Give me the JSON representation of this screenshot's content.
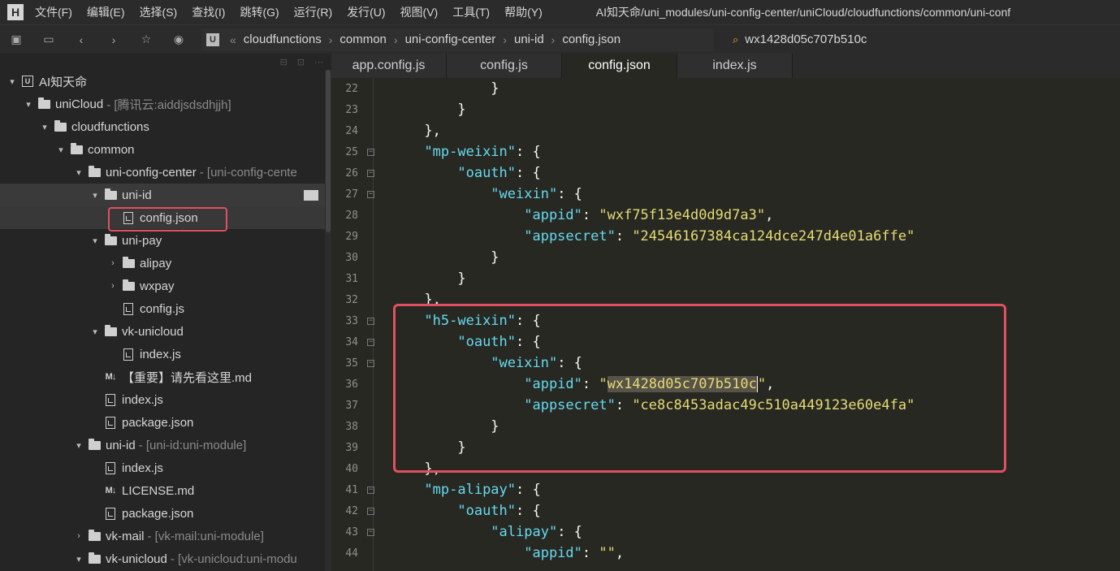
{
  "menubar": {
    "logo": "H",
    "items": [
      "文件(F)",
      "编辑(E)",
      "选择(S)",
      "查找(I)",
      "跳转(G)",
      "运行(R)",
      "发行(U)",
      "视图(V)",
      "工具(T)",
      "帮助(Y)"
    ],
    "title": "AI知天命/uni_modules/uni-config-center/uniCloud/cloudfunctions/common/uni-conf"
  },
  "toolbar": {
    "breadcrumb": [
      "cloudfunctions",
      "common",
      "uni-config-center",
      "uni-id",
      "config.json"
    ],
    "search_value": "wx1428d05c707b510c"
  },
  "sidebar": {
    "tree": [
      {
        "label": "AI知天命",
        "muted": "",
        "arrow": "▾",
        "icon": "project"
      },
      {
        "label": "uniCloud",
        "muted": "- [腾讯云:aiddjsdsdhjjh]",
        "arrow": "▾",
        "icon": "folder"
      },
      {
        "label": "cloudfunctions",
        "muted": "",
        "arrow": "▾",
        "icon": "folder"
      },
      {
        "label": "common",
        "muted": "",
        "arrow": "▾",
        "icon": "folder"
      },
      {
        "label": "uni-config-center",
        "muted": "- [uni-config-cente",
        "arrow": "▾",
        "icon": "folder"
      },
      {
        "label": "uni-id",
        "muted": "",
        "arrow": "▾",
        "icon": "folder"
      },
      {
        "label": "config.json",
        "muted": "",
        "arrow": "",
        "icon": "file"
      },
      {
        "label": "uni-pay",
        "muted": "",
        "arrow": "▾",
        "icon": "folder"
      },
      {
        "label": "alipay",
        "muted": "",
        "arrow": "›",
        "icon": "folder"
      },
      {
        "label": "wxpay",
        "muted": "",
        "arrow": "›",
        "icon": "folder"
      },
      {
        "label": "config.js",
        "muted": "",
        "arrow": "",
        "icon": "file"
      },
      {
        "label": "vk-unicloud",
        "muted": "",
        "arrow": "▾",
        "icon": "folder"
      },
      {
        "label": "index.js",
        "muted": "",
        "arrow": "",
        "icon": "file"
      },
      {
        "label": "【重要】请先看这里.md",
        "muted": "",
        "arrow": "",
        "icon": "md"
      },
      {
        "label": "index.js",
        "muted": "",
        "arrow": "",
        "icon": "file"
      },
      {
        "label": "package.json",
        "muted": "",
        "arrow": "",
        "icon": "file"
      },
      {
        "label": "uni-id",
        "muted": "- [uni-id:uni-module]",
        "arrow": "▾",
        "icon": "folder"
      },
      {
        "label": "index.js",
        "muted": "",
        "arrow": "",
        "icon": "file"
      },
      {
        "label": "LICENSE.md",
        "muted": "",
        "arrow": "",
        "icon": "md"
      },
      {
        "label": "package.json",
        "muted": "",
        "arrow": "",
        "icon": "file"
      },
      {
        "label": "vk-mail",
        "muted": "- [vk-mail:uni-module]",
        "arrow": "›",
        "icon": "folder"
      },
      {
        "label": "vk-unicloud",
        "muted": "- [vk-unicloud:uni-modu",
        "arrow": "▾",
        "icon": "folder"
      }
    ]
  },
  "editor": {
    "tabs": [
      "app.config.js",
      "config.js",
      "config.json",
      "index.js"
    ],
    "active_tab": 2,
    "lines": [
      {
        "n": "22",
        "fold": false,
        "indent": 12,
        "parts": [
          [
            "p",
            "}"
          ]
        ]
      },
      {
        "n": "23",
        "fold": false,
        "indent": 8,
        "parts": [
          [
            "p",
            "}"
          ]
        ]
      },
      {
        "n": "24",
        "fold": false,
        "indent": 4,
        "parts": [
          [
            "p",
            "},"
          ]
        ]
      },
      {
        "n": "25",
        "fold": true,
        "indent": 4,
        "parts": [
          [
            "k",
            "\"mp-weixin\""
          ],
          [
            "p",
            ": {"
          ]
        ]
      },
      {
        "n": "26",
        "fold": true,
        "indent": 8,
        "parts": [
          [
            "k",
            "\"oauth\""
          ],
          [
            "p",
            ": {"
          ]
        ]
      },
      {
        "n": "27",
        "fold": true,
        "indent": 12,
        "parts": [
          [
            "k",
            "\"weixin\""
          ],
          [
            "p",
            ": {"
          ]
        ]
      },
      {
        "n": "28",
        "fold": false,
        "indent": 16,
        "parts": [
          [
            "k",
            "\"appid\""
          ],
          [
            "p",
            ": "
          ],
          [
            "s",
            "\"wxf75f13e4d0d9d7a3\""
          ],
          [
            "p",
            ","
          ]
        ]
      },
      {
        "n": "29",
        "fold": false,
        "indent": 16,
        "parts": [
          [
            "k",
            "\"appsecret\""
          ],
          [
            "p",
            ": "
          ],
          [
            "s",
            "\"24546167384ca124dce247d4e01a6ffe\""
          ]
        ]
      },
      {
        "n": "30",
        "fold": false,
        "indent": 12,
        "parts": [
          [
            "p",
            "}"
          ]
        ]
      },
      {
        "n": "31",
        "fold": false,
        "indent": 8,
        "parts": [
          [
            "p",
            "}"
          ]
        ]
      },
      {
        "n": "32",
        "fold": false,
        "indent": 4,
        "parts": [
          [
            "p",
            "},"
          ]
        ]
      },
      {
        "n": "33",
        "fold": true,
        "indent": 4,
        "parts": [
          [
            "k",
            "\"h5-weixin\""
          ],
          [
            "p",
            ": {"
          ]
        ]
      },
      {
        "n": "34",
        "fold": true,
        "indent": 8,
        "parts": [
          [
            "k",
            "\"oauth\""
          ],
          [
            "p",
            ": {"
          ]
        ]
      },
      {
        "n": "35",
        "fold": true,
        "indent": 12,
        "parts": [
          [
            "k",
            "\"weixin\""
          ],
          [
            "p",
            ": {"
          ]
        ]
      },
      {
        "n": "36",
        "fold": false,
        "indent": 16,
        "parts": [
          [
            "k",
            "\"appid\""
          ],
          [
            "p",
            ": "
          ],
          [
            "s",
            "\""
          ],
          [
            "sel",
            "wx1428d05c707b510c"
          ],
          [
            "cursor",
            ""
          ],
          [
            "s",
            "\""
          ],
          [
            "p",
            ","
          ]
        ]
      },
      {
        "n": "37",
        "fold": false,
        "indent": 16,
        "parts": [
          [
            "k",
            "\"appsecret\""
          ],
          [
            "p",
            ": "
          ],
          [
            "s",
            "\"ce8c8453adac49c510a449123e60e4fa\""
          ]
        ]
      },
      {
        "n": "38",
        "fold": false,
        "indent": 12,
        "parts": [
          [
            "p",
            "}"
          ]
        ]
      },
      {
        "n": "39",
        "fold": false,
        "indent": 8,
        "parts": [
          [
            "p",
            "}"
          ]
        ]
      },
      {
        "n": "40",
        "fold": false,
        "indent": 4,
        "parts": [
          [
            "p",
            "},"
          ]
        ]
      },
      {
        "n": "41",
        "fold": true,
        "indent": 4,
        "parts": [
          [
            "k",
            "\"mp-alipay\""
          ],
          [
            "p",
            ": {"
          ]
        ]
      },
      {
        "n": "42",
        "fold": true,
        "indent": 8,
        "parts": [
          [
            "k",
            "\"oauth\""
          ],
          [
            "p",
            ": {"
          ]
        ]
      },
      {
        "n": "43",
        "fold": true,
        "indent": 12,
        "parts": [
          [
            "k",
            "\"alipay\""
          ],
          [
            "p",
            ": {"
          ]
        ]
      },
      {
        "n": "44",
        "fold": false,
        "indent": 16,
        "parts": [
          [
            "k",
            "\"appid\""
          ],
          [
            "p",
            ": "
          ],
          [
            "s",
            "\"\""
          ],
          [
            "p",
            ","
          ]
        ]
      }
    ]
  }
}
